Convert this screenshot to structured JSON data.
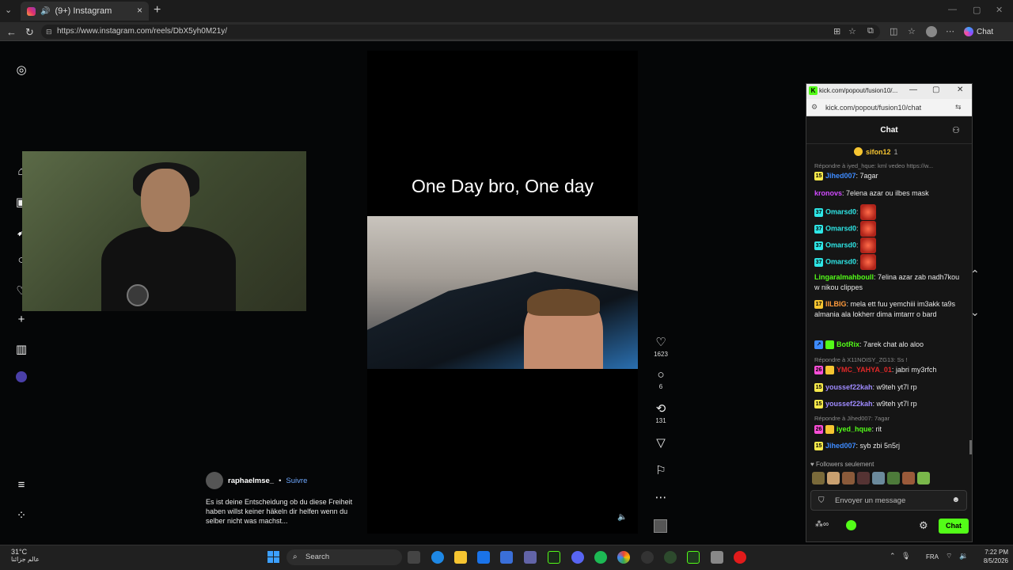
{
  "browser": {
    "tab_title": "(9+) Instagram",
    "url": "https://www.instagram.com/reels/DbX5yh0M21y/",
    "chat_label": "Chat"
  },
  "reel": {
    "overlay_text": "One Day bro, One day",
    "author": "raphaelmse_",
    "follow_label": "Suivre",
    "separator": "•",
    "caption": "Es ist deine Entscheidung ob du diese Freiheit haben willst keiner häkeln dir helfen wenn du selber nicht was machst...",
    "likes": "1623",
    "comments": "6",
    "reposts": "131"
  },
  "kick_popup": {
    "window_title": "kick.com/popout/fusion10/...",
    "url": "kick.com/popout/fusion10/chat",
    "header": "Chat",
    "pinned_user": "sifon12",
    "pinned_count": "1",
    "messages": [
      {
        "reply": "Répondre à iyed_hque: kml vedeo https://w..."
      },
      {
        "badge": "15",
        "badge_color": "#f6e94a",
        "user": "Jihed007",
        "color": "#3d8bff",
        "text": ": 7agar"
      },
      {
        "user": "kronovs",
        "color": "#d14bff",
        "text": ": 7elena azar ou ilbes mask"
      },
      {
        "badge": "37",
        "badge_color": "#2ee6e6",
        "user": "Omarsd0",
        "color": "#2ee6e6",
        "text": ":",
        "emote": true
      },
      {
        "badge": "37",
        "badge_color": "#2ee6e6",
        "user": "Omarsd0",
        "color": "#2ee6e6",
        "text": ":",
        "emote": true
      },
      {
        "badge": "37",
        "badge_color": "#2ee6e6",
        "user": "Omarsd0",
        "color": "#2ee6e6",
        "text": ":",
        "emote": true
      },
      {
        "badge": "37",
        "badge_color": "#2ee6e6",
        "user": "Omarsd0",
        "color": "#2ee6e6",
        "text": ":",
        "emote": true
      },
      {
        "user": "Lingaralmahboull",
        "color": "#53fc18",
        "text": ": 7elina azar zab nadh7kou w nikou clippes"
      },
      {
        "badge": "17",
        "badge_color": "#f6c531",
        "user": "llLBIG",
        "color": "#ff9a3c",
        "text": ": mela ett fuu yemchiii im3akk ta9s almania ala lokherr dima imtarrr o bard"
      },
      {
        "badge": "↗",
        "badge_color": "#3d8bff",
        "user": "BotRix",
        "color": "#53fc18",
        "text": ": 7arek chat alo aloo"
      },
      {
        "reply": "Répondre à X11NOISY_ZG13: Ss !"
      },
      {
        "badge": "26",
        "badge_color": "#ff4fd8",
        "user": "YMC_YAHYA_01",
        "color": "#e02828",
        "text": ": jabri my3rfch"
      },
      {
        "badge": "15",
        "badge_color": "#f6e94a",
        "user": "youssef22kah",
        "color": "#9f8bff",
        "text": ": w9teh yt7l rp"
      },
      {
        "badge": "15",
        "badge_color": "#f6e94a",
        "user": "youssef22kah",
        "color": "#9f8bff",
        "text": ": w9teh yt7l rp"
      },
      {
        "reply": "Répondre à Jihed007: 7agar"
      },
      {
        "badge": "26",
        "badge_color": "#ff4fd8",
        "user": "iyed_hque",
        "color": "#53fc18",
        "text": ": rit"
      },
      {
        "badge": "15",
        "badge_color": "#f6e94a",
        "user": "Jihed007",
        "color": "#3d8bff",
        "text": ": syb zbi 5n5rj"
      }
    ],
    "followers_label": "Followers seulement",
    "input_placeholder": "Envoyer un message",
    "send_label": "Chat"
  },
  "taskbar": {
    "temperature": "31°C",
    "weather_text": "عالم جزائنا",
    "search_label": "Search",
    "lang": "FRA",
    "time": "7:22 PM",
    "date": "8/5/2026"
  }
}
